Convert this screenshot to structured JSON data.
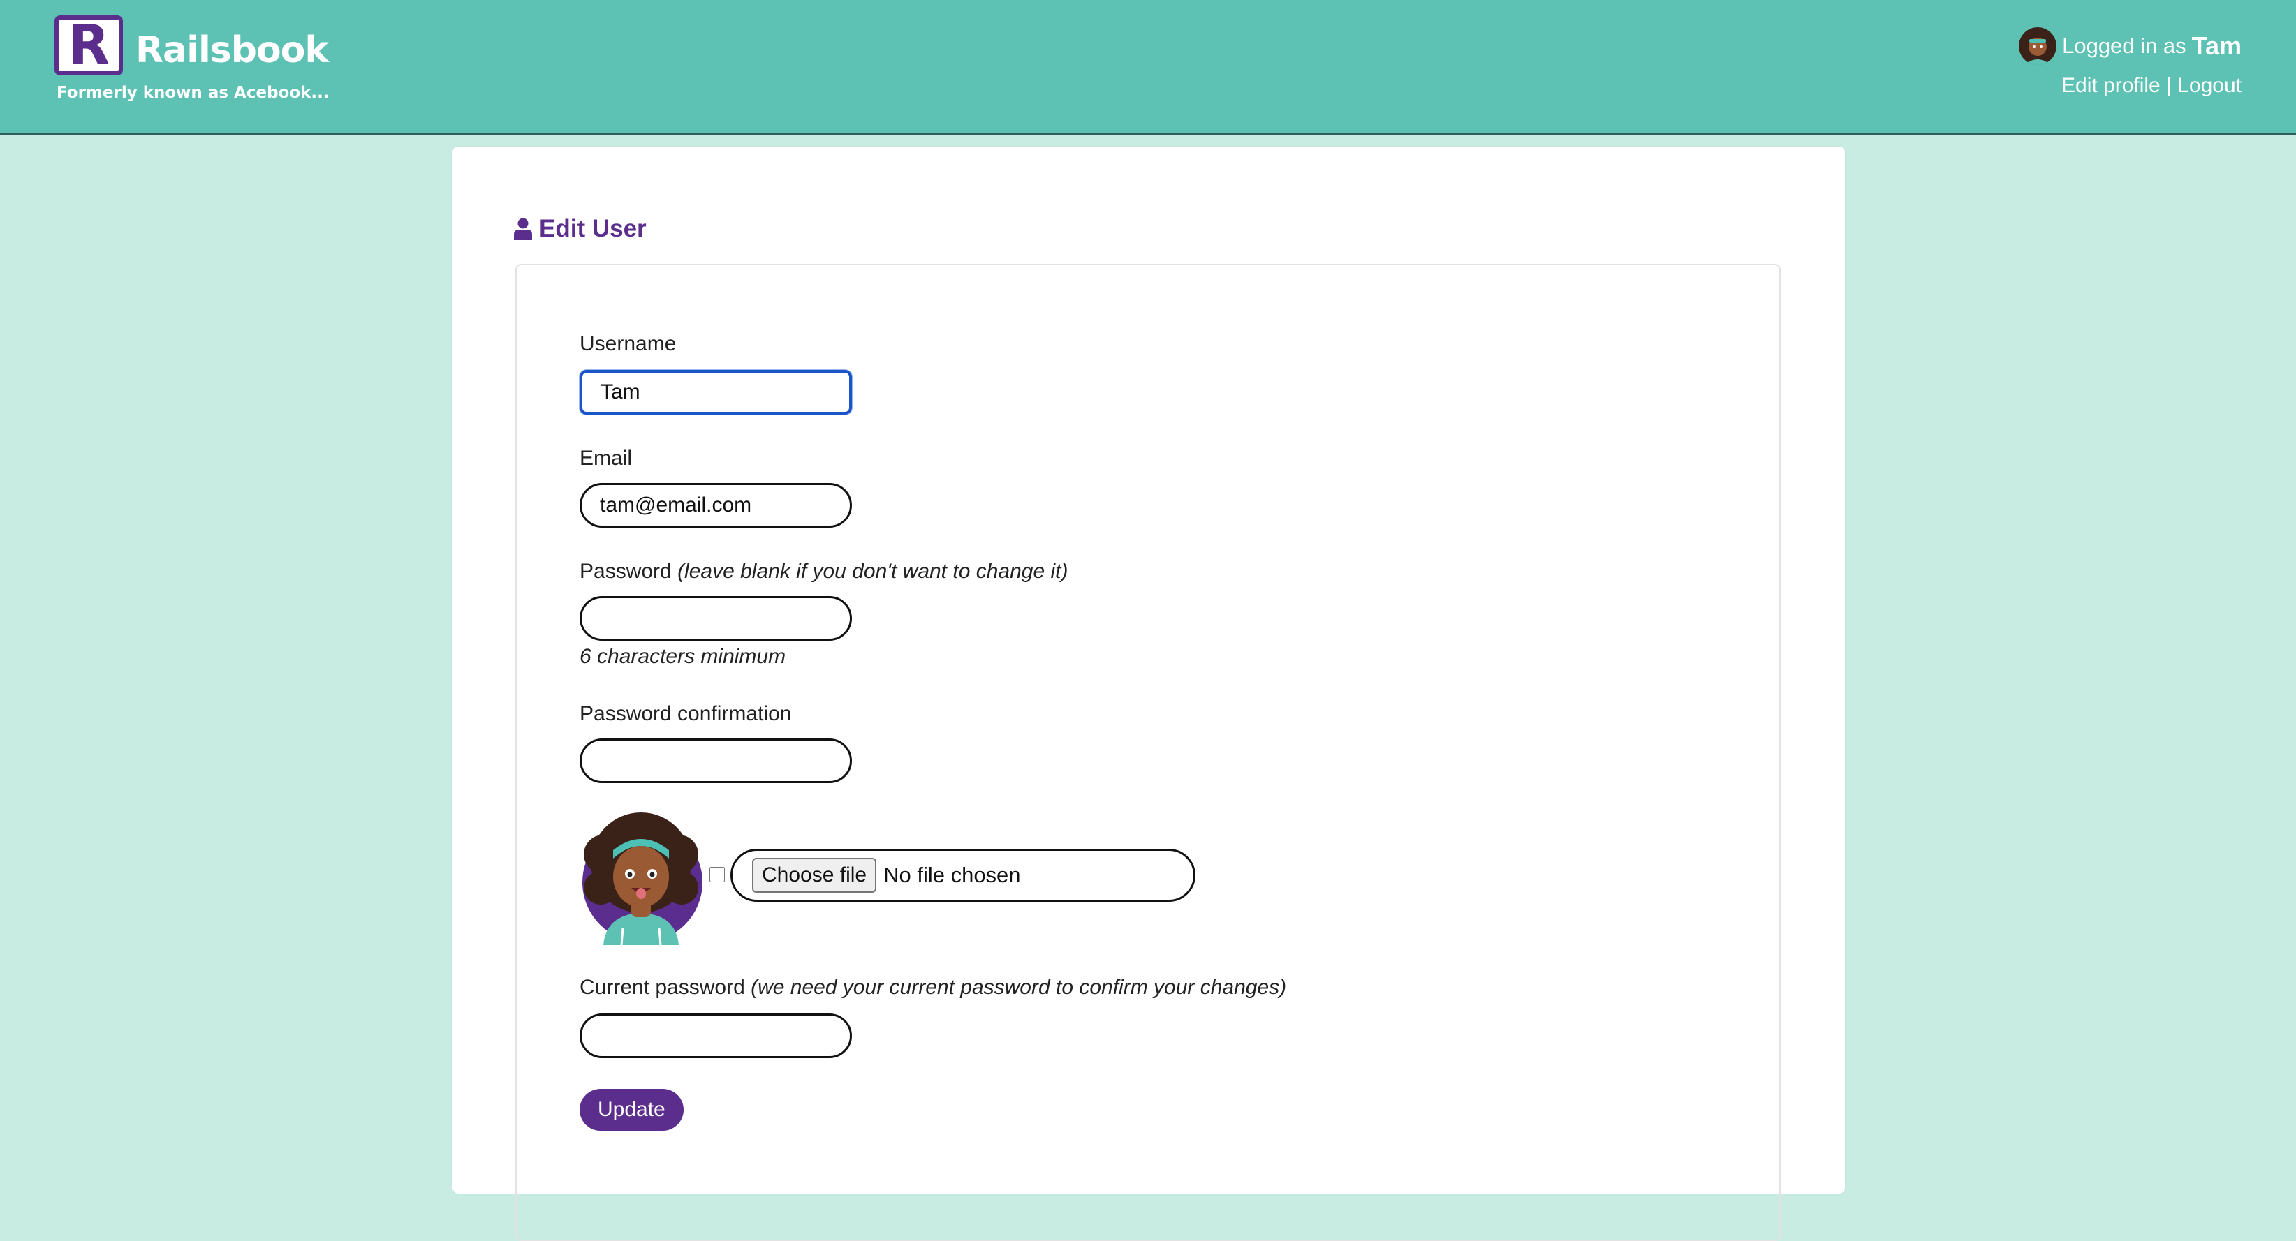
{
  "header": {
    "logo_letter": "R",
    "brand_name": "Railsbook",
    "tagline": "Formerly known as Acebook...",
    "logged_in_prefix": "Logged in as",
    "username": "Tam",
    "edit_profile": "Edit profile",
    "separator": "|",
    "logout": "Logout"
  },
  "page": {
    "title": "Edit User",
    "title_icon": "user-icon"
  },
  "form": {
    "username_label": "Username",
    "username_value": "Tam",
    "email_label": "Email",
    "email_value": "tam@email.com",
    "password_label": "Password",
    "password_note": "(leave blank if you don't want to change it)",
    "password_hint": "6 characters minimum",
    "password_confirmation_label": "Password confirmation",
    "avatar_icon": "avatar-image",
    "choose_file_label": "Choose file",
    "no_file_text": "No file chosen",
    "current_password_label": "Current password",
    "current_password_note": "(we need your current password to confirm your changes)",
    "update_label": "Update"
  },
  "colors": {
    "header_bg": "#5dc1b3",
    "page_bg": "#c8ece2",
    "accent": "#5b2d8c",
    "focus_ring": "#1a56c8"
  }
}
